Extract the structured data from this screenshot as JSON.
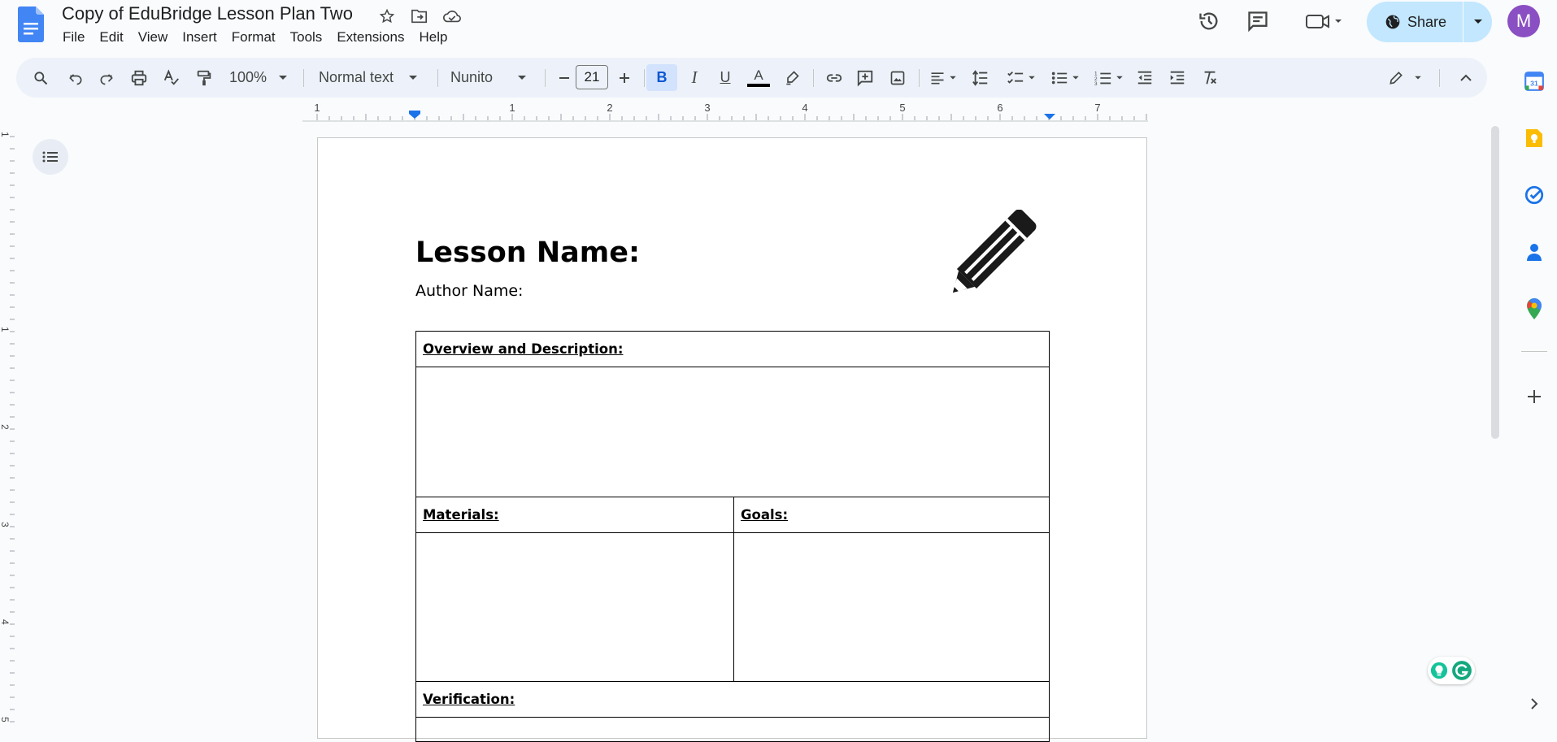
{
  "app": {
    "doc_title": "Copy of EduBridge Lesson Plan Two",
    "menu": [
      "File",
      "Edit",
      "View",
      "Insert",
      "Format",
      "Tools",
      "Extensions",
      "Help"
    ],
    "share_label": "Share",
    "avatar_letter": "M"
  },
  "toolbar": {
    "zoom": "100%",
    "style": "Normal text",
    "font": "Nunito",
    "font_size": "21",
    "text_color": "#000000",
    "icons": [
      "search-icon",
      "undo-icon",
      "redo-icon",
      "print-icon",
      "spellcheck-icon",
      "paint-format-icon",
      "bold-icon",
      "italic-icon",
      "underline-icon",
      "text-color-icon",
      "highlight-icon",
      "link-icon",
      "comment-icon",
      "image-icon",
      "align-icon",
      "line-spacing-icon",
      "checklist-icon",
      "bullet-list-icon",
      "numbered-list-icon",
      "decrease-indent-icon",
      "increase-indent-icon",
      "clear-format-icon",
      "edit-mode-icon",
      "collapse-icon"
    ]
  },
  "ruler": {
    "h_labels": [
      "1",
      "1",
      "2",
      "3",
      "4",
      "5",
      "6",
      "7"
    ],
    "v_labels": [
      "1",
      "1",
      "2",
      "3",
      "4",
      "5"
    ]
  },
  "document": {
    "lesson_name": "Lesson Name:",
    "author_name": "Author Name:",
    "table": {
      "overview": "Overview and Description:",
      "materials": "Materials:",
      "goals": "Goals:",
      "verification": "Verification:"
    }
  },
  "colors": {
    "accent": "#0b57d0",
    "share_bg": "#c2e7ff",
    "toolbar_bg": "#edf2fa",
    "avatar_bg": "#8a4fc2"
  }
}
